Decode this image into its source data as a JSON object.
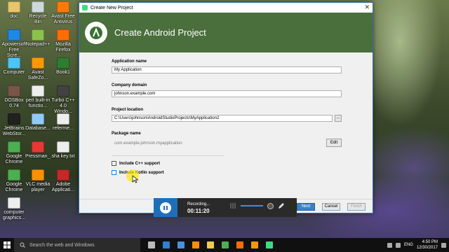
{
  "desktop": {
    "icons": [
      {
        "label": "doc",
        "color": "#e9c46a"
      },
      {
        "label": "Recycle Bin",
        "color": "#cfd8dc"
      },
      {
        "label": "Avast Free Antivirus",
        "color": "#ff7a00"
      },
      {
        "label": "Apowersoft Free Scre...",
        "color": "#1e88e5"
      },
      {
        "label": "Notepad++",
        "color": "#8bc34a"
      },
      {
        "label": "Mozilla Firefox",
        "color": "#ff6d00"
      },
      {
        "label": "Computer",
        "color": "#4fc3f7"
      },
      {
        "label": "Avast SafeZo...",
        "color": "#ff9800"
      },
      {
        "label": "Book1",
        "color": "#2e7d32"
      },
      {
        "label": "DOSBox 0.74",
        "color": "#795548"
      },
      {
        "label": "perl built-in functio...",
        "color": "#eeeeee"
      },
      {
        "label": "Turbo C++ 4.0 Windo...",
        "color": "#424242"
      },
      {
        "label": "JetBrains WebStor...",
        "color": "#212121"
      },
      {
        "label": "Database...",
        "color": "#90caf9"
      },
      {
        "label": "referme...",
        "color": "#eeeeee"
      },
      {
        "label": "Google Chrome",
        "color": "#4caf50"
      },
      {
        "label": "Pressman_...",
        "color": "#e53935"
      },
      {
        "label": "sha key.txt",
        "color": "#eeeeee"
      },
      {
        "label": "Google Chrome",
        "color": "#4caf50"
      },
      {
        "label": "VLC media player",
        "color": "#ff8f00"
      },
      {
        "label": "Adobe Applicati...",
        "color": "#c62828"
      },
      {
        "label": "computer graphics...",
        "color": "#eeeeee"
      }
    ]
  },
  "dialog": {
    "window_title": "Create New Project",
    "banner_title": "Create Android Project",
    "fields": {
      "app_name_label": "Application name",
      "app_name_value": "My Application",
      "company_label": "Company domain",
      "company_value": "johnson.example.com",
      "location_label": "Project location",
      "location_value": "C:\\Users\\johnson\\AndroidStudioProjects\\MyApplication2",
      "browse_label": "...",
      "package_label": "Package name",
      "package_value": "com.example.johnson.myapplication",
      "edit_label": "Edit"
    },
    "checks": {
      "cpp_label": "Include C++ support",
      "kotlin_label": "Include Kotlin support"
    },
    "footer": {
      "next": "Next",
      "cancel": "Cancel",
      "finish": "Finish"
    }
  },
  "recorder": {
    "status": "Recording...",
    "time": "00:11:20"
  },
  "taskbar": {
    "search_placeholder": "Search the web and Windows",
    "time": "4:50 PM",
    "date": "12/30/2017",
    "lang": "ENG",
    "pinned": [
      {
        "name": "task-view-icon",
        "color": "#bbbbbb"
      },
      {
        "name": "edge-icon",
        "color": "#2f7fd8"
      },
      {
        "name": "store-icon",
        "color": "#4a90d9"
      },
      {
        "name": "vlc-icon",
        "color": "#ff8f00"
      },
      {
        "name": "explorer-icon",
        "color": "#f2c94c"
      },
      {
        "name": "chrome-icon",
        "color": "#4caf50"
      },
      {
        "name": "firefox-icon",
        "color": "#ff6d00"
      },
      {
        "name": "avast-icon",
        "color": "#ff9800"
      },
      {
        "name": "android-studio-icon",
        "color": "#3ddc84"
      }
    ]
  },
  "colors": {
    "banner": "#4a6e3c",
    "primary_button": "#3f7ecf",
    "recorder_accent": "#1f6fb8"
  }
}
